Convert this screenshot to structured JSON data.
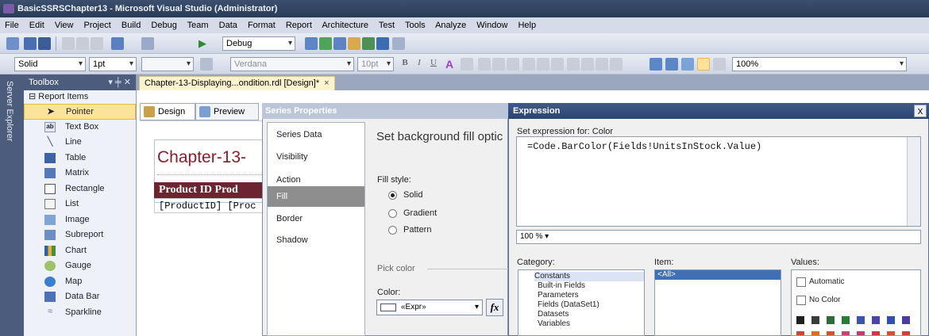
{
  "window": {
    "title": "BasicSSRSChapter13 - Microsoft Visual Studio (Administrator)"
  },
  "menu": [
    "File",
    "Edit",
    "View",
    "Project",
    "Build",
    "Debug",
    "Team",
    "Data",
    "Format",
    "Report",
    "Architecture",
    "Test",
    "Tools",
    "Analyze",
    "Window",
    "Help"
  ],
  "toolbar1": {
    "config_value": "Debug"
  },
  "toolbar2": {
    "line_style": "Solid",
    "line_width": "1pt",
    "font_name": "Verdana",
    "font_size": "10pt",
    "zoom": "100%"
  },
  "server_explorer": {
    "label": "Server Explorer"
  },
  "toolbox": {
    "title": "Toolbox",
    "group": "Report Items",
    "items": [
      "Pointer",
      "Text Box",
      "Line",
      "Table",
      "Matrix",
      "Rectangle",
      "List",
      "Image",
      "Subreport",
      "Chart",
      "Gauge",
      "Map",
      "Data Bar",
      "Sparkline"
    ]
  },
  "document": {
    "tab_label": "Chapter-13-Displaying...ondition.rdl [Design]*",
    "tab_close": "×",
    "design_tab": "Design",
    "preview_tab": "Preview"
  },
  "report": {
    "title": "Chapter-13-",
    "header_cells": "Product ID Prod",
    "row_cells": "[ProductID] [Proc"
  },
  "series_properties": {
    "title": "Series Properties",
    "nav": [
      "Series Data",
      "Visibility",
      "Action",
      "Fill",
      "Border",
      "Shadow"
    ],
    "selected_nav": "Fill",
    "heading": "Set background fill optic",
    "fill_style_label": "Fill style:",
    "fill_options": [
      "Solid",
      "Gradient",
      "Pattern"
    ],
    "pick_color_label": "Pick color",
    "color_label": "Color:",
    "color_value": "«Expr»",
    "fx_label": "fx"
  },
  "expression": {
    "title": "Expression",
    "close": "x",
    "set_for_label": "Set expression for: Color",
    "text": "=Code.BarColor(Fields!UnitsInStock.Value)",
    "zoom": "100 %",
    "category_label": "Category:",
    "item_label": "Item:",
    "values_label": "Values:",
    "categories": [
      "Constants",
      "Built-in Fields",
      "Parameters",
      "Fields (DataSet1)",
      "Datasets",
      "Variables"
    ],
    "items": [
      "<All>"
    ],
    "value_options": [
      "Automatic",
      "No Color"
    ],
    "palette_row1": [
      "#1f1f1f",
      "#3b3b3b",
      "#2f6a3a",
      "#2a7a3a",
      "#3a55b0",
      "#4a43a8",
      "#2f4fb5",
      "#4b3ca0"
    ],
    "palette_row2": [
      "#c24a3a",
      "#d96c2c",
      "#cc5530",
      "#c04a6a",
      "#b8406a",
      "#cc3a4a",
      "#d2503a",
      "#c74444"
    ]
  }
}
